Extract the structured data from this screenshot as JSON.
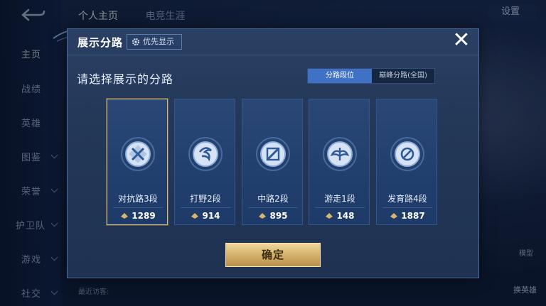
{
  "background": {
    "top_tabs": [
      "个人主页",
      "电竞生涯"
    ],
    "sidebar_items": [
      {
        "label": "主页",
        "active": true,
        "chevron": false
      },
      {
        "label": "战绩",
        "active": false,
        "chevron": false
      },
      {
        "label": "英雄",
        "active": false,
        "chevron": false
      },
      {
        "label": "图鉴",
        "active": false,
        "chevron": true
      },
      {
        "label": "荣誉",
        "active": false,
        "chevron": true
      },
      {
        "label": "护卫队",
        "active": false,
        "chevron": true
      },
      {
        "label": "游戏",
        "active": false,
        "chevron": true
      },
      {
        "label": "社交",
        "active": false,
        "chevron": true
      }
    ],
    "settings_label": "设置",
    "recent_visitors": "最近访客:",
    "model_label": "模型",
    "switch_hero_label": "换英雄"
  },
  "dialog": {
    "title": "展示分路",
    "priority_label": "优先显示",
    "close_symbol": "✕",
    "subtitle": "请选择展示的分路",
    "segments": [
      {
        "label": "分路段位",
        "active": true
      },
      {
        "label": "巅峰分路(全国)",
        "active": false
      }
    ],
    "cards": [
      {
        "name": "对抗路3段",
        "score": "1289",
        "selected": true,
        "icon": "sword-crossed-icon"
      },
      {
        "name": "打野2段",
        "score": "914",
        "selected": false,
        "icon": "swirl-icon"
      },
      {
        "name": "中路2段",
        "score": "895",
        "selected": false,
        "icon": "staff-icon"
      },
      {
        "name": "游走1段",
        "score": "148",
        "selected": false,
        "icon": "wings-icon"
      },
      {
        "name": "发育路4段",
        "score": "1887",
        "selected": false,
        "icon": "target-icon"
      }
    ],
    "confirm_label": "确定"
  },
  "colors": {
    "accent_blue": "#3f72c4",
    "gold": "#d7b56e",
    "dialog_bg": "#233757"
  }
}
